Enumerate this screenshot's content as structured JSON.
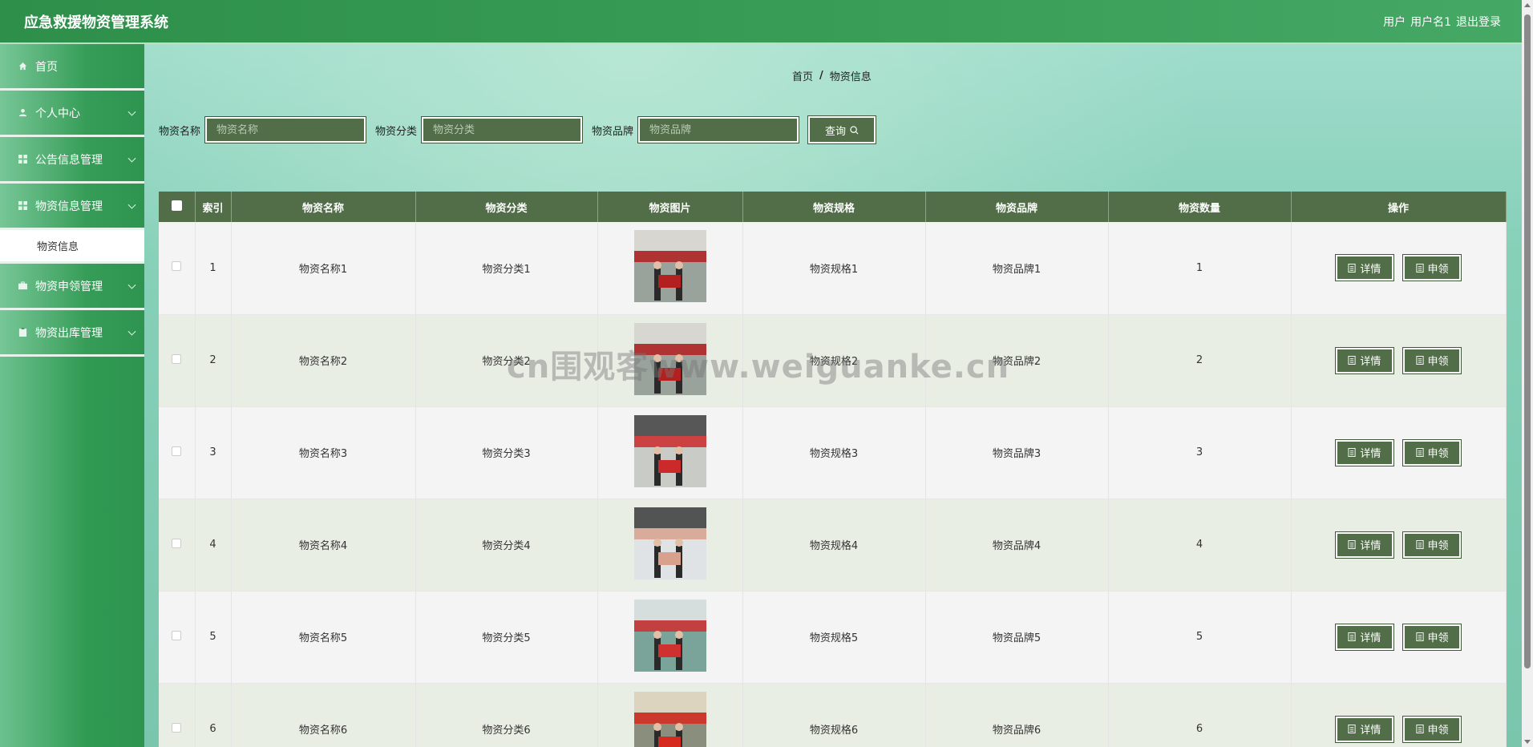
{
  "header": {
    "app_title": "应急救援物资管理系统",
    "user_label": "用户",
    "user_name": "用户名1",
    "logout_label": "退出登录"
  },
  "sidebar": {
    "items": [
      {
        "label": "首页",
        "icon": "home-icon",
        "expandable": false
      },
      {
        "label": "个人中心",
        "icon": "user-icon",
        "expandable": true
      },
      {
        "label": "公告信息管理",
        "icon": "grid-icon",
        "expandable": true
      },
      {
        "label": "物资信息管理",
        "icon": "grid-icon",
        "expandable": true
      },
      {
        "label": "物资申领管理",
        "icon": "briefcase-icon",
        "expandable": true
      },
      {
        "label": "物资出库管理",
        "icon": "clipboard-icon",
        "expandable": true
      }
    ],
    "submenu": {
      "label": "物资信息"
    }
  },
  "breadcrumb": {
    "home": "首页",
    "separator": "/",
    "current": "物资信息"
  },
  "search": {
    "name_label": "物资名称",
    "name_placeholder": "物资名称",
    "category_label": "物资分类",
    "category_placeholder": "物资分类",
    "brand_label": "物资品牌",
    "brand_placeholder": "物资品牌",
    "button_label": "查询"
  },
  "table": {
    "columns": [
      "索引",
      "物资名称",
      "物资分类",
      "物资图片",
      "物资规格",
      "物资品牌",
      "物资数量",
      "操作"
    ],
    "detail_label": "详情",
    "apply_label": "申领",
    "rows": [
      {
        "index": "1",
        "name": "物资名称1",
        "category": "物资分类1",
        "spec": "物资规格1",
        "brand": "物资品牌1",
        "qty": "1"
      },
      {
        "index": "2",
        "name": "物资名称2",
        "category": "物资分类2",
        "spec": "物资规格2",
        "brand": "物资品牌2",
        "qty": "2"
      },
      {
        "index": "3",
        "name": "物资名称3",
        "category": "物资分类3",
        "spec": "物资规格3",
        "brand": "物资品牌3",
        "qty": "3"
      },
      {
        "index": "4",
        "name": "物资名称4",
        "category": "物资分类4",
        "spec": "物资规格4",
        "brand": "物资品牌4",
        "qty": "4"
      },
      {
        "index": "5",
        "name": "物资名称5",
        "category": "物资分类5",
        "spec": "物资规格5",
        "brand": "物资品牌5",
        "qty": "5"
      },
      {
        "index": "6",
        "name": "物资名称6",
        "category": "物资分类6",
        "spec": "物资规格6",
        "brand": "物资品牌6",
        "qty": "6"
      }
    ]
  },
  "watermark": "cn围观客www.weiguanke.cn",
  "colors": {
    "header_green": "#2d8f4a",
    "button_green": "#516e48",
    "sidebar_green": "#2f9a52"
  }
}
